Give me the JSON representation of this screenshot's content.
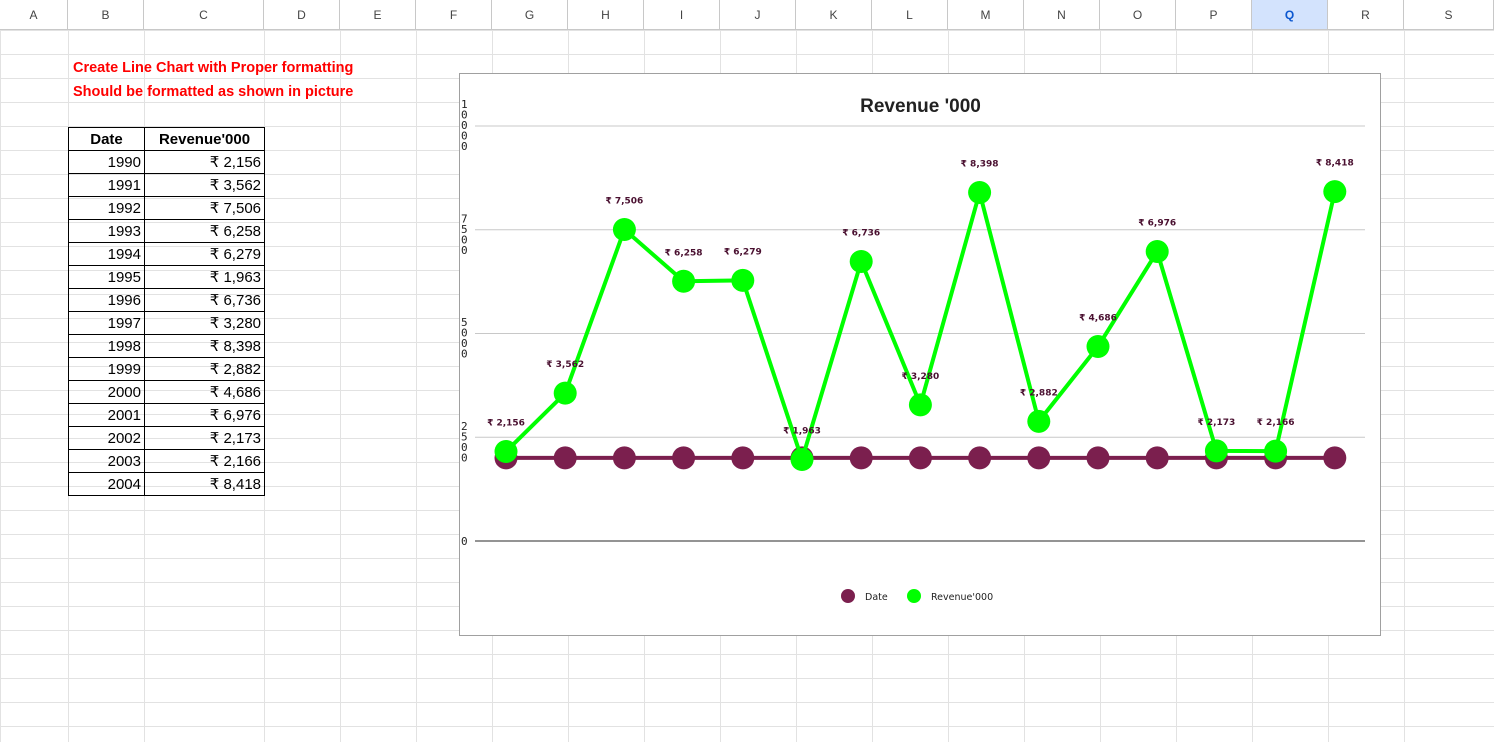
{
  "sheet": {
    "columns": [
      "A",
      "B",
      "C",
      "D",
      "E",
      "F",
      "G",
      "H",
      "I",
      "J",
      "K",
      "L",
      "M",
      "N",
      "O",
      "P",
      "Q",
      "R",
      "S"
    ],
    "selected_column": "Q"
  },
  "notes": {
    "line1": "Create Line Chart with Proper formatting",
    "line2": "Should be formatted as shown in picture"
  },
  "table": {
    "headers": [
      "Date",
      "Revenue'000"
    ],
    "rows": [
      [
        "1990",
        "₹ 2,156"
      ],
      [
        "1991",
        "₹ 3,562"
      ],
      [
        "1992",
        "₹ 7,506"
      ],
      [
        "1993",
        "₹ 6,258"
      ],
      [
        "1994",
        "₹ 6,279"
      ],
      [
        "1995",
        "₹ 1,963"
      ],
      [
        "1996",
        "₹ 6,736"
      ],
      [
        "1997",
        "₹ 3,280"
      ],
      [
        "1998",
        "₹ 8,398"
      ],
      [
        "1999",
        "₹ 2,882"
      ],
      [
        "2000",
        "₹ 4,686"
      ],
      [
        "2001",
        "₹ 6,976"
      ],
      [
        "2002",
        "₹ 2,173"
      ],
      [
        "2003",
        "₹ 2,166"
      ],
      [
        "2004",
        "₹ 8,418"
      ]
    ]
  },
  "chart_data": {
    "type": "line",
    "title": "Revenue '000",
    "ylim": [
      0,
      10000
    ],
    "ytick_labels": [
      "0",
      "2500",
      "5000",
      "7500",
      "10000"
    ],
    "ytick_values": [
      0,
      2500,
      5000,
      7500,
      10000
    ],
    "grid": true,
    "legend_position": "bottom",
    "series": [
      {
        "name": "Date",
        "color": "#7b1f4e",
        "values": [
          1990,
          1991,
          1992,
          1993,
          1994,
          1995,
          1996,
          1997,
          1998,
          1999,
          2000,
          2001,
          2002,
          2003,
          2004
        ]
      },
      {
        "name": "Revenue'000",
        "color": "#00ff00",
        "values": [
          2156,
          3562,
          7506,
          6258,
          6279,
          1963,
          6736,
          3280,
          8398,
          2882,
          4686,
          6976,
          2173,
          2166,
          8418
        ],
        "data_labels": [
          "₹ 2,156",
          "₹ 3,562",
          "₹ 7,506",
          "₹ 6,258",
          "₹ 6,279",
          "₹ 1,963",
          "₹ 6,736",
          "₹ 3,280",
          "₹ 8,398",
          "₹ 2,882",
          "₹ 4,686",
          "₹ 6,976",
          "₹ 2,173",
          "₹ 2,166",
          "₹ 8,418"
        ]
      }
    ]
  }
}
